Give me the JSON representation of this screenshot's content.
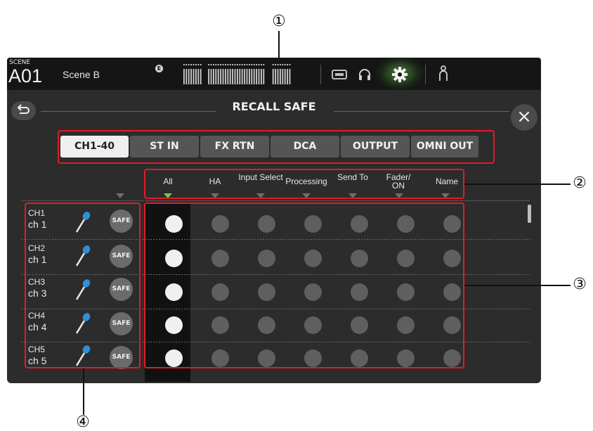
{
  "scene": {
    "label": "SCENE",
    "number": "A01",
    "name": "Scene B",
    "edit_badge": "E"
  },
  "panel": {
    "title": "RECALL SAFE"
  },
  "tabs": [
    {
      "label": "CH1-40",
      "active": true
    },
    {
      "label": "ST IN",
      "active": false
    },
    {
      "label": "FX RTN",
      "active": false
    },
    {
      "label": "DCA",
      "active": false
    },
    {
      "label": "OUTPUT",
      "active": false
    },
    {
      "label": "OMNI OUT",
      "active": false
    }
  ],
  "columns": [
    "All",
    "HA",
    "Input Select",
    "Processing",
    "Send To",
    "Fader/ ON",
    "Name"
  ],
  "channels": [
    {
      "number": "CH1",
      "name": "ch 1",
      "safe": "SAFE"
    },
    {
      "number": "CH2",
      "name": "ch 1",
      "safe": "SAFE"
    },
    {
      "number": "CH3",
      "name": "ch 3",
      "safe": "SAFE"
    },
    {
      "number": "CH4",
      "name": "ch 4",
      "safe": "SAFE"
    },
    {
      "number": "CH5",
      "name": "ch 5",
      "safe": "SAFE"
    }
  ],
  "callouts": [
    "①",
    "②",
    "③",
    "④"
  ],
  "colors": {
    "accent_green": "#79c64a",
    "annotation_red": "#e21a2a",
    "panel": "#2c2c2c"
  },
  "icons": [
    "back-arrow-icon",
    "close-icon",
    "recorder-icon",
    "headphones-icon",
    "gear-icon",
    "user-icon",
    "microphone-icon"
  ]
}
